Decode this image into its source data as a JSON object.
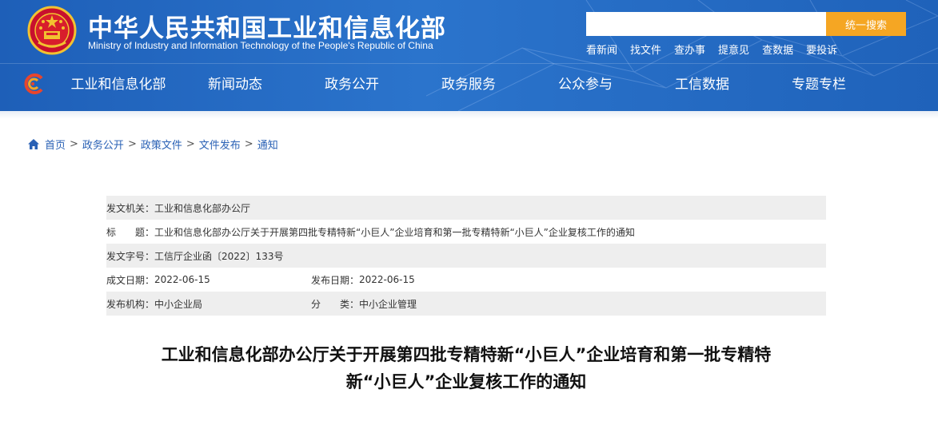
{
  "header": {
    "title": "中华人民共和国工业和信息化部",
    "subtitle": "Ministry of Industry and Information Technology of the People's Republic of China",
    "search": {
      "placeholder": "",
      "button_label": "统一搜索"
    },
    "quick_links": [
      "看新闻",
      "找文件",
      "查办事",
      "提意见",
      "查数据",
      "要投诉"
    ]
  },
  "nav": {
    "items": [
      "工业和信息化部",
      "新闻动态",
      "政务公开",
      "政务服务",
      "公众参与",
      "工信数据",
      "专题专栏"
    ]
  },
  "breadcrumb": {
    "items": [
      "首页",
      "政务公开",
      "政策文件",
      "文件发布",
      "通知"
    ],
    "separator": ">"
  },
  "meta": {
    "issuer_label": "发文机关：",
    "issuer": "工业和信息化部办公厅",
    "title_label": "标　　题：",
    "title": "工业和信息化部办公厅关于开展第四批专精特新“小巨人”企业培育和第一批专精特新“小巨人”企业复核工作的通知",
    "doc_no_label": "发文字号：",
    "doc_no": "工信厅企业函〔2022〕133号",
    "written_date_label": "成文日期：",
    "written_date": "2022-06-15",
    "publish_date_label": "发布日期：",
    "publish_date": "2022-06-15",
    "agency_label": "发布机构：",
    "agency": "中小企业局",
    "category_label": "分　　类：",
    "category": "中小企业管理"
  },
  "article": {
    "title_line1": "工业和信息化部办公厅关于开展第四批专精特新“小巨人”企业培育和第一批专精特",
    "title_line2": "新“小巨人”企业复核工作的通知"
  },
  "colors": {
    "header_blue": "#2b74cc",
    "search_button": "#f5a623",
    "link_blue": "#2a61b5",
    "row_alt": "#eeeeee"
  }
}
